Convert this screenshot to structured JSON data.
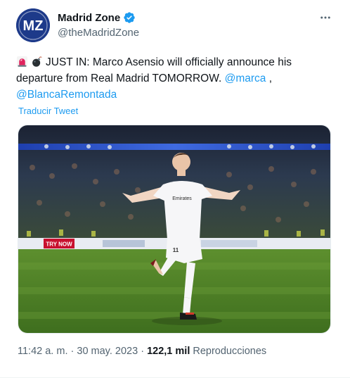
{
  "account": {
    "avatar_text": "MZ",
    "name": "Madrid Zone",
    "handle": "@theMadridZone"
  },
  "tweet": {
    "text_main": "JUST IN: Marco Asensio will officially announce his departure from Real Madrid TOMORROW.",
    "mention_1": "@marca",
    "separator": ",",
    "mention_2": "@BlancaRemontada",
    "emoji_1": "rotating-light-icon",
    "emoji_2": "bomb-icon"
  },
  "translate_label": "Traducir Tweet",
  "media": {
    "sign_text": "TRY NOW",
    "jersey_sponsor": "Emirates",
    "jersey_number": "11"
  },
  "meta": {
    "time": "11:42 a. m.",
    "dot1": "·",
    "date": "30 may. 2023",
    "dot2": "·",
    "views_count": "122,1 mil",
    "views_label": "Reproducciones"
  },
  "colors": {
    "accent": "#1d9bf0",
    "text": "#0f1419",
    "secondary": "#536471"
  }
}
